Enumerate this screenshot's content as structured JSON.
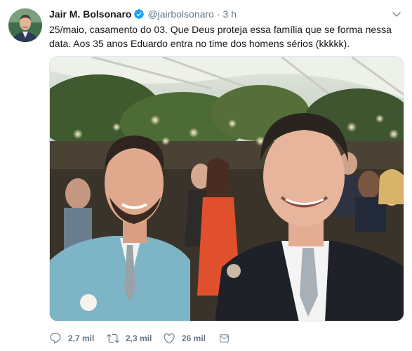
{
  "tweet": {
    "author": {
      "display_name": "Jair M. Bolsonaro",
      "verified": true,
      "username": "@jairbolsonaro",
      "avatar_icon": "profile-avatar"
    },
    "separator": "·",
    "time": "3 h",
    "text_lines": [
      "25/maio, casamento do 03. Que Deus proteja essa família que se forma nessa",
      "data. Aos 35 anos Eduardo entra no time dos homens sérios (kkkkk)."
    ],
    "media": {
      "kind": "photo",
      "icon": "wedding-selfie-photo"
    },
    "actions": {
      "reply": {
        "icon": "reply-icon",
        "count": "2,7 mil"
      },
      "retweet": {
        "icon": "retweet-icon",
        "count": "2,3 mil"
      },
      "like": {
        "icon": "heart-icon",
        "count": "26 mil"
      },
      "dm": {
        "icon": "envelope-icon"
      }
    },
    "more_icon": "chevron-down-icon"
  },
  "colors": {
    "text_primary": "#14171a",
    "text_secondary": "#657786",
    "verified_blue": "#1da1f2",
    "border": "#e1e8ed"
  }
}
